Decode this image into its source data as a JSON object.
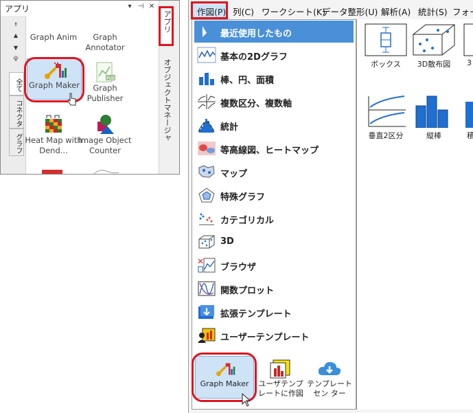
{
  "apps_panel": {
    "title": "アプリ",
    "header_buttons": [
      "▾",
      "⊣",
      "✕"
    ],
    "side_tabs": [
      "全て",
      "コネクタ",
      "グラフ"
    ],
    "right_tab": "アプリ",
    "right_tab_2": "オブジェクトマネージャ",
    "apps": [
      {
        "label": "Graph Anim"
      },
      {
        "label": "Graph Annotator"
      },
      {
        "label": "Graph Maker"
      },
      {
        "label": "Graph Publisher"
      },
      {
        "label": "Heat Map with Dend..."
      },
      {
        "label": "Image Object Counter"
      }
    ]
  },
  "menubar": {
    "items": [
      "作図(P)",
      "列(C)",
      "ワークシート(K)",
      "データ整形(U)",
      "解析(A)",
      "統計(S)",
      "フォー"
    ]
  },
  "plot_menu": {
    "items": [
      {
        "label": "最近使用したもの"
      },
      {
        "label": "基本の2Dグラフ"
      },
      {
        "label": "棒、円、面積"
      },
      {
        "label": "複数区分、複数軸"
      },
      {
        "label": "統計"
      },
      {
        "label": "等高線図、ヒートマップ"
      },
      {
        "label": "マップ"
      },
      {
        "label": "特殊グラフ"
      },
      {
        "label": "カテゴリカル"
      },
      {
        "label": "3D"
      },
      {
        "label": "ブラウザ"
      },
      {
        "label": "関数プロット"
      },
      {
        "label": "拡張テンプレート"
      },
      {
        "label": "ユーザーテンプレート"
      }
    ],
    "bottom_tiles": [
      {
        "label": "Graph Maker"
      },
      {
        "label": "ユーザテンプ レートに作図"
      },
      {
        "label": "テンプレートセン ター"
      }
    ]
  },
  "gallery": {
    "tiles": [
      {
        "label": "ボックス"
      },
      {
        "label": "3D散布図"
      },
      {
        "label": "3"
      },
      {
        "label": "垂直2区分"
      },
      {
        "label": "縦棒"
      },
      {
        "label": "積"
      }
    ]
  },
  "colors": {
    "highlight": "#e0141e",
    "menu_selected": "#4a90d9",
    "bar_blue": "#1f6fd1"
  }
}
